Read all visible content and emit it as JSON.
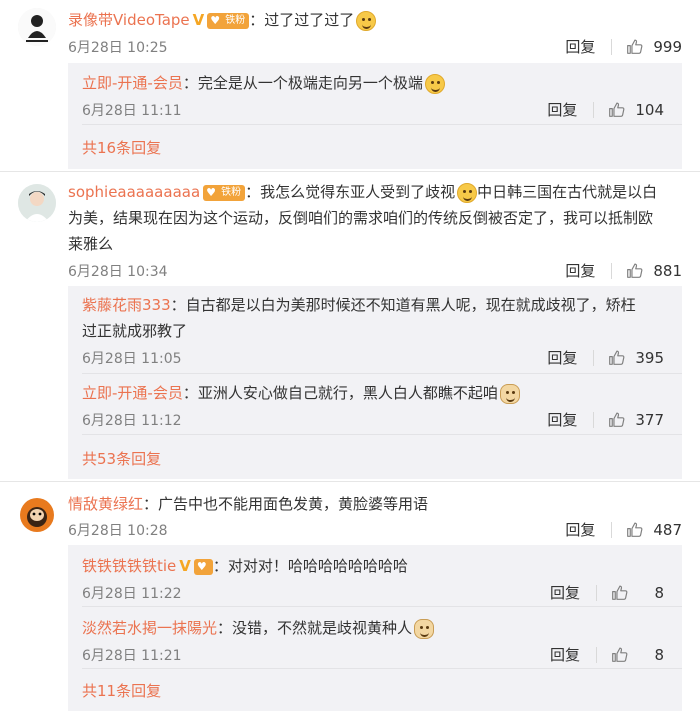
{
  "comments": [
    {
      "user": "录像带VideoTape",
      "text": "：过了过了过了",
      "time": "6月28日 10:25",
      "reply_label": "回复",
      "likes": "999",
      "replies": [
        {
          "user": "立即-开通-会员",
          "text": "：完全是从一个极端走向另一个极端",
          "time": "6月28日 11:11",
          "reply_label": "回复",
          "likes": "104"
        }
      ],
      "more": "共16条回复"
    },
    {
      "user": "sophieaaaaaaaaa",
      "text_line1": "：我怎么觉得东亚人受到了歧视",
      "text_line1b": "中日韩三国在古代就是以白",
      "text_line2": "为美，结果现在因为这个运动，反倒咱们的需求咱们的传统反倒被否定了，我可以抵制欧",
      "text_line3": "莱雅么",
      "time": "6月28日 10:34",
      "reply_label": "回复",
      "likes": "881",
      "replies": [
        {
          "user": "紫藤花雨333",
          "text_line1": "：自古都是以白为美那时候还不知道有黑人呢，现在就成歧视了，矫枉",
          "text_line2": "过正就成邪教了",
          "time": "6月28日 11:05",
          "reply_label": "回复",
          "likes": "395"
        },
        {
          "user": "立即-开通-会员",
          "text": "：亚洲人安心做自己就行，黑人白人都瞧不起咱",
          "time": "6月28日 11:12",
          "reply_label": "回复",
          "likes": "377"
        }
      ],
      "more": "共53条回复"
    },
    {
      "user": "情敌黄绿红",
      "text": "：广告中也不能用面色发黄，黄脸婆等用语",
      "time": "6月28日 10:28",
      "reply_label": "回复",
      "likes": "487",
      "replies": [
        {
          "user": "铁铁铁铁铁tie",
          "text": "：对对对！哈哈哈哈哈哈哈哈",
          "time": "6月28日 11:22",
          "reply_label": "回复",
          "likes": "8"
        },
        {
          "user": "淡然若水掲一抹陽光",
          "text": "：没错，不然就是歧视黄种人",
          "time": "6月28日 11:21",
          "reply_label": "回复",
          "likes": "8"
        }
      ],
      "more": "共11条回复"
    }
  ],
  "badges": {
    "fan_label": "铁粉",
    "v_mark": "V"
  },
  "colors": {
    "username": "#eb7350",
    "reply_bg": "#f2f2f5",
    "meta": "#808080"
  }
}
